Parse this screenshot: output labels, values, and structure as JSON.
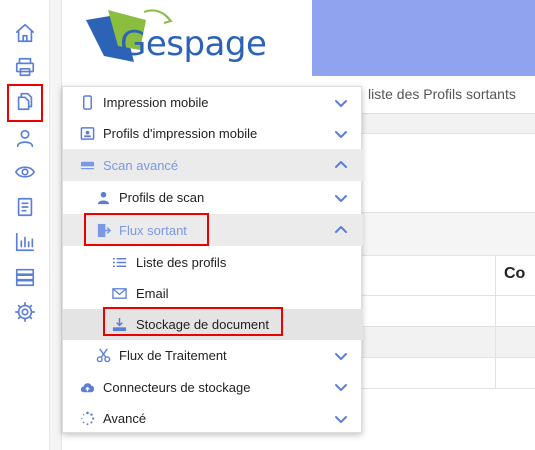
{
  "header": {
    "logo_text": "Gespage",
    "breadcrumb": "liste des Profils sortants"
  },
  "rail": {
    "items": [
      {
        "icon": "home-icon"
      },
      {
        "icon": "printer-icon"
      },
      {
        "icon": "documents-icon"
      },
      {
        "icon": "user-icon"
      },
      {
        "icon": "eye-icon"
      },
      {
        "icon": "book-icon"
      },
      {
        "icon": "bar-chart-icon"
      },
      {
        "icon": "server-icon"
      },
      {
        "icon": "gear-icon"
      }
    ]
  },
  "table": {
    "header_cell": "Co"
  },
  "menu": {
    "impression_mobile": "Impression mobile",
    "profils_impression_mobile": "Profils d'impression mobile",
    "scan_avance": "Scan avancé",
    "profils_de_scan": "Profils de scan",
    "flux_sortant": "Flux sortant",
    "liste_des_profils": "Liste des profils",
    "email": "Email",
    "stockage_de_document": "Stockage de document",
    "flux_de_traitement": "Flux de Traitement",
    "connecteurs_de_stockage": "Connecteurs de stockage",
    "avance": "Avancé"
  },
  "colors": {
    "accent": "#5b7fd6",
    "banner": "#8fa3ee",
    "highlight": "#e00000"
  }
}
